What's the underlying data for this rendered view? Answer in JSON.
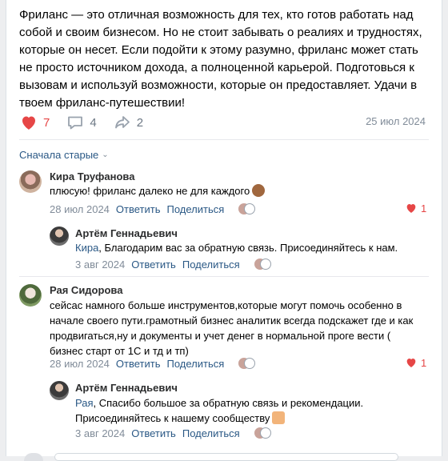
{
  "post": {
    "text": "Фриланс — это отличная возможность для тех, кто готов работать над собой и своим бизнесом. Но не стоит забывать о реалиях и трудностях, которые он несет. Если подойти к этому разумно, фриланс может стать не просто источником дохода, а полноценной карьерой. Подготовься к вызовам и используй возможности, которые он предоставляет. Удачи в твоем фриланс-путешествии!",
    "likes": "7",
    "comments": "4",
    "shares": "2",
    "date": "25 июл 2024"
  },
  "sort_label": "Сначала старые",
  "labels": {
    "reply": "Ответить",
    "share": "Поделиться"
  },
  "comments": [
    {
      "name": "Кира Труфанова",
      "text": "плюсую! фриланс далеко не для каждого",
      "emoji": "monkey-see-no-evil",
      "date": "28 июл 2024",
      "likes": "1",
      "reply": {
        "name": "Артём Геннадьевич",
        "mention": "Кира",
        "text": ", Благодарим вас за обратную связь. Присоединяйтесь к нам.",
        "date": "3 авг 2024"
      }
    },
    {
      "name": "Рая Сидорова",
      "text": "сейсас намного больше инструментов,которые могут помочь особенно в начале своего пути.грамотный бизнес аналитик всегда подскажет где и как продвигаться,ну и документы и учет денег в нормальной проге вести ( бизнес старт от 1С и тд и тп)",
      "date": "28 июл 2024",
      "likes": "1",
      "reply": {
        "name": "Артём Геннадьевич",
        "mention": "Рая",
        "text": ", Спасибо большое за обратную связь и рекомендации. Присоединяйтесь к нашему сообществу",
        "emoji": "thumbs-up",
        "date": "3 авг 2024"
      }
    }
  ],
  "colors": {
    "accent": "#2a5885",
    "like": "#e64646",
    "muted": "#818c99"
  }
}
